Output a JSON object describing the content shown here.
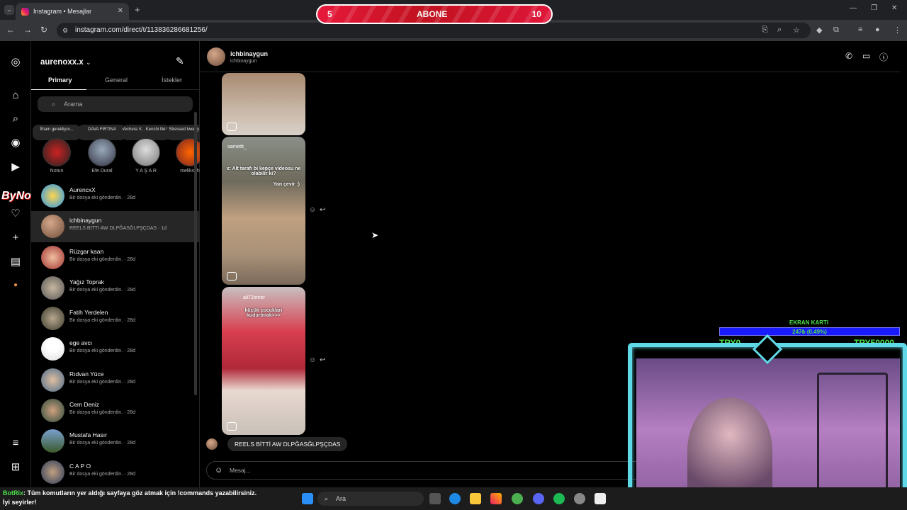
{
  "browser": {
    "tab_title": "Instagram • Mesajlar",
    "url": "instagram.com/direct/t/113836286681256/"
  },
  "subscribe_bar": {
    "left": "5",
    "label": "ABONE",
    "right": "10"
  },
  "sidebar": {
    "username": "aurenoxx.x",
    "tabs": [
      "Primary",
      "General",
      "İstekler"
    ],
    "search_placeholder": "Arama",
    "notes": [
      {
        "bubble": "İlham gerekliyor...",
        "name": "Notun"
      },
      {
        "bubble": "DAVA FIRTINA",
        "name": "Efe Dural"
      },
      {
        "bubble": "Vechera V... Kenshi Nett. al...",
        "name": "Y A Ş A R"
      },
      {
        "bubble": "Stressed twenty one p",
        "name": "meliksah"
      }
    ],
    "conversations": [
      {
        "name": "AurencxX",
        "preview": "Bir dosya eki gönderdin. · 28d"
      },
      {
        "name": "ichbinaygun",
        "preview": "REELS BİTTİ AW DLPĞASĞLPŞÇDAS · 1d"
      },
      {
        "name": "Rüzgar kaan",
        "preview": "Bir dosya eki gönderdin. · 28d"
      },
      {
        "name": "Yağız Toprak",
        "preview": "Bir dosya eki gönderdin. · 28d"
      },
      {
        "name": "Fatih Yerdelen",
        "preview": "Bir dosya eki gönderdin. · 28d"
      },
      {
        "name": "ege avcı",
        "preview": "Bir dosya eki gönderdin. · 28d"
      },
      {
        "name": "Rıdvan Yüce",
        "preview": "Bir dosya eki gönderdin. · 28d"
      },
      {
        "name": "Cem Deniz",
        "preview": "Bir dosya eki gönderdin. · 28d"
      },
      {
        "name": "Mustafa Hasır",
        "preview": "Bir dosya eki gönderdin. · 28d"
      },
      {
        "name": "C A P O",
        "preview": "Bir dosya eki gönderdin. · 28d"
      }
    ]
  },
  "chat": {
    "name": "ichbinaygun",
    "handle": "ichbinaygun",
    "reel2_user": "samettt_",
    "reel2_text": "x: Alt tarafı bi kepçe videosu ne olabilir ki?",
    "reel2_sub": "Yan çevir :)",
    "reel3_user": "ali72omer",
    "reel3_text": "küçük çocukları kudurtmak>>>",
    "last_message": "REELS BİTTİ AW DLPĞASĞLPŞÇDAS",
    "composer_placeholder": "Mesaj..."
  },
  "overlay": {
    "watermark": "ByNoGame",
    "gpu_title": "EKRAN KARTI",
    "gpu_progress": "247₺ (0.49%)",
    "gpu_min": "TRY0",
    "gpu_max": "TRY50000"
  },
  "chat_overlay": {
    "bot": "BotRix",
    "message": ": Tüm komutların yer aldığı sayfaya göz atmak için !commands yazabilirsiniz. İyi seyirler!"
  },
  "taskbar": {
    "search": "Ara"
  }
}
